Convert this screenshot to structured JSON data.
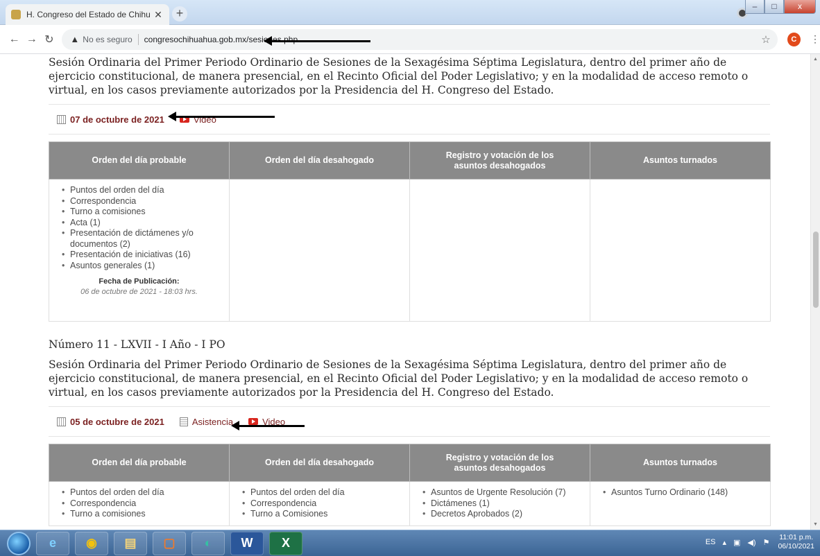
{
  "browser": {
    "tab_title": "H. Congreso del Estado de Chihu",
    "tab_close": "✕",
    "new_tab": "+",
    "security_label": "No es seguro",
    "url": "congresochihuahua.gob.mx/sesiones.php",
    "profile_initial": "C",
    "icons": [
      "back-icon",
      "forward-icon",
      "reload-icon",
      "warning-icon",
      "star-icon",
      "menu-icon"
    ]
  },
  "sessions": [
    {
      "description": "Sesión Ordinaria del Primer Periodo Ordinario de Sesiones de la Sexagésima Séptima Legislatura, dentro del primer año de ejercicio constitucional, de manera presencial, en el Recinto Oficial del Poder Legislativo; y en la modalidad de acceso remoto o virtual, en los casos previamente autorizados por la Presidencia del H. Congreso del Estado.",
      "date": "07 de octubre de 2021",
      "video_label": "Video",
      "columns": [
        "Orden del día probable",
        "Orden del día desahogado",
        "Registro y votación de los asuntos desahogados",
        "Asuntos turnados"
      ],
      "probable": [
        "Puntos del orden del día",
        "Correspondencia",
        "Turno a comisiones",
        "Acta (1)",
        "Presentación de dictámenes y/o documentos (2)",
        "Presentación de iniciativas (16)",
        "Asuntos generales (1)"
      ],
      "pub_label": "Fecha de Publicación:",
      "pub_value": "06 de octubre de 2021 - 18:03 hrs."
    },
    {
      "number": "Número 11 - LXVII - I Año - I PO",
      "description": "Sesión Ordinaria del Primer Periodo Ordinario de Sesiones de la Sexagésima Séptima Legislatura, dentro del primer año de ejercicio constitucional, de manera presencial, en el Recinto Oficial del Poder Legislativo; y en la modalidad de acceso remoto o virtual, en los casos previamente autorizados por la Presidencia del H. Congreso del Estado.",
      "date": "05 de octubre de 2021",
      "attendance_label": "Asistencia",
      "video_label": "Video",
      "columns": [
        "Orden del día probable",
        "Orden del día desahogado",
        "Registro y votación de los asuntos desahogados",
        "Asuntos turnados"
      ],
      "probable": [
        "Puntos del orden del día",
        "Correspondencia",
        "Turno a comisiones"
      ],
      "desahogado": [
        "Puntos del orden del día",
        "Correspondencia",
        "Turno a Comisiones"
      ],
      "registro": [
        "Asuntos de Urgente Resolución (7)",
        "Dictámenes (1)",
        "Decretos Aprobados (2)"
      ],
      "turnados": [
        "Asuntos Turno Ordinario (148)"
      ]
    }
  ],
  "taskbar": {
    "apps": [
      "ie-icon",
      "chrome-icon",
      "explorer-icon",
      "media-icon",
      "edge-icon",
      "word-icon",
      "excel-icon"
    ],
    "app_letters": [
      "e",
      "◉",
      "▤",
      "▢",
      "◐",
      "W",
      "X"
    ],
    "lang": "ES",
    "time": "11:01 p.m.",
    "date": "06/10/2021"
  }
}
